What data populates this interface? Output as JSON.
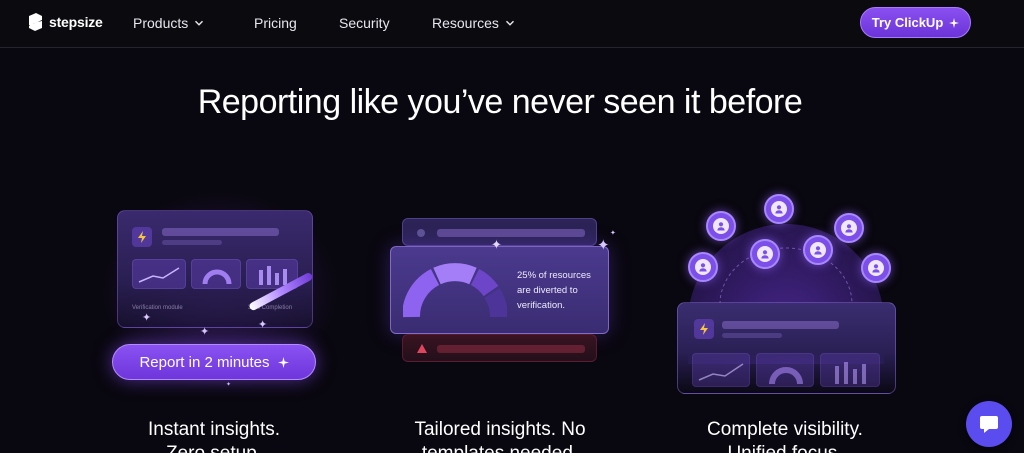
{
  "nav": {
    "logo_text": "stepsize",
    "items": [
      {
        "label": "Products",
        "has_dropdown": true
      },
      {
        "label": "Pricing",
        "has_dropdown": false
      },
      {
        "label": "Security",
        "has_dropdown": false
      },
      {
        "label": "Resources",
        "has_dropdown": true
      }
    ],
    "cta_label": "Try ClickUp"
  },
  "hero": {
    "title": "Reporting like you’ve never seen it before"
  },
  "cards": [
    {
      "illustration": {
        "module_label": "Verification module",
        "completion_label": "33% Completion",
        "button_label": "Report in 2 minutes"
      },
      "caption_line1": "Instant insights.",
      "caption_line2": "Zero setup."
    },
    {
      "illustration": {
        "text": "25% of resources are diverted to verification."
      },
      "caption_line1": "Tailored insights. No",
      "caption_line2": "templates needed."
    },
    {
      "caption_line1": "Complete visibility.",
      "caption_line2": "Unified focus."
    }
  ],
  "icons": {
    "logo": "stepsize-logo-icon",
    "sparkle": "sparkle-icon",
    "bolt": "bolt-icon",
    "user": "user-icon",
    "warning": "warning-icon",
    "chat": "chat-icon",
    "chevron": "chevron-down-icon"
  },
  "colors": {
    "background": "#09070f",
    "accent": "#7b45e6",
    "chat": "#5b4cf0"
  }
}
